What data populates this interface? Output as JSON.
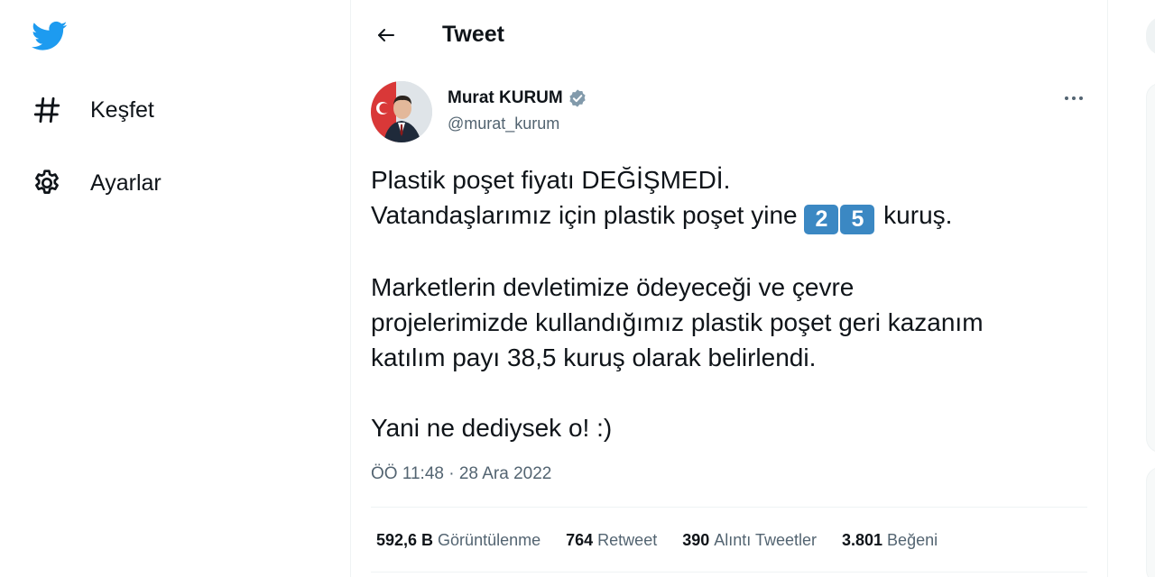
{
  "sidebar": {
    "logo_icon": "twitter-bird-icon",
    "items": [
      {
        "label": "Keşfet",
        "icon": "hashtag-icon"
      },
      {
        "label": "Ayarlar",
        "icon": "gear-icon"
      }
    ]
  },
  "header": {
    "title": "Tweet",
    "back_icon": "back-arrow-icon"
  },
  "tweet": {
    "author": {
      "name": "Murat KURUM",
      "handle": "@murat_kurum",
      "verified_icon": "verified-badge-icon"
    },
    "more_icon": "more-horizontal-icon",
    "text": {
      "line1": "Plastik poşet fiyatı DEĞİŞMEDİ.",
      "line2_before": "Vatandaşlarımız için plastik poşet yine",
      "keycap_1": "2",
      "keycap_2": "5",
      "line2_after": "kuruş.",
      "line3": "Marketlerin devletimize ödeyeceği ve çevre",
      "line4": "projelerimizde kullandığımız plastik poşet geri kazanım",
      "line5": "katılım payı 38,5 kuruş olarak belirlendi.",
      "line6": "Yani ne dediysek o! :)"
    },
    "timestamp": "ÖÖ 11:48 · 28 Ara 2022",
    "stats": {
      "views": {
        "value": "592,6 B",
        "label": "Görüntülenme"
      },
      "retweets": {
        "value": "764",
        "label": "Retweet"
      },
      "quotes": {
        "value": "390",
        "label": "Alıntı Tweetler"
      },
      "likes": {
        "value": "3.801",
        "label": "Beğeni"
      }
    }
  },
  "colors": {
    "brand_blue": "#1d9bf0",
    "text_primary": "#0f1419",
    "text_secondary": "#536471",
    "keycap_blue": "#3b88c3",
    "divider": "#eff3f4"
  }
}
